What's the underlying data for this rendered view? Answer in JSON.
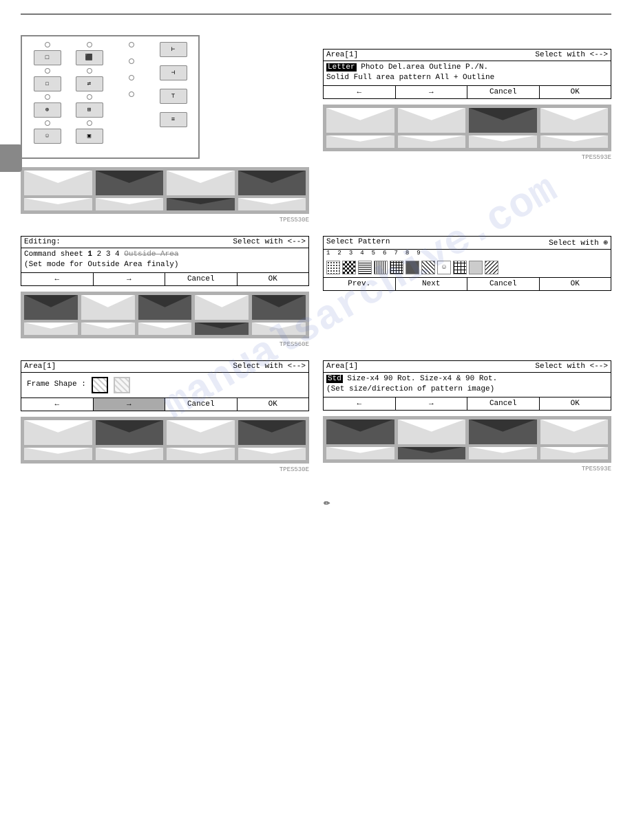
{
  "page": {
    "top_divider": true,
    "watermark": "manualsarchive.com"
  },
  "gray_tab": {
    "label": ""
  },
  "area1_dialog": {
    "title": "Area[1]",
    "select_label": "Select with <-->",
    "options_line1": "Letter  Photo  Del.area  Outline  P./N.",
    "options_line2": "Solid  Full area pattern  All + Outline",
    "highlighted": "Letter",
    "btn_left": "←",
    "btn_right": "→",
    "btn_cancel": "Cancel",
    "btn_ok": "OK"
  },
  "editing_dialog": {
    "title": "Editing:",
    "select_label": "Select with <-->",
    "line1": "Command sheet 1 2 3 4  Outside Area",
    "line1_bold": "1",
    "line1_strikethrough": "Outside Area",
    "line2": "(Set mode for Outside Area finaly)",
    "btn_left": "←",
    "btn_right": "→",
    "btn_cancel": "Cancel",
    "btn_ok": "OK"
  },
  "select_pattern_dialog": {
    "title": "Select Pattern",
    "select_label": "Select with ⊕",
    "numbers": [
      "1",
      "2",
      "3",
      "4",
      "5",
      "6",
      "7",
      "8",
      "9"
    ],
    "btn_prev": "Prev.",
    "btn_next": "Next",
    "btn_cancel": "Cancel",
    "btn_ok": "OK"
  },
  "area1_frame_dialog": {
    "title": "Area[1]",
    "select_label": "Select with <-->",
    "label": "Frame Shape :",
    "btn_left": "←",
    "btn_right": "→",
    "btn_cancel": "Cancel",
    "btn_ok": "OK"
  },
  "area1_size_dialog": {
    "title": "Area[1]",
    "select_label": "Select with <-->",
    "options": "Std  Size-x4  90 Rot.  Size-x4 & 90 Rot.",
    "highlighted": "Std",
    "line2": "(Set size/direction of pattern image)",
    "btn_left": "←",
    "btn_right": "→",
    "btn_cancel": "Cancel",
    "btn_ok": "OK"
  },
  "labels": {
    "tpes530e_1": "TPES530E",
    "tpes560e": "TPES560E",
    "tpes530e_2": "TPES530E",
    "tpes530e_3": "TPES530E",
    "tpes530e_4": "TPES530E",
    "tpes593e": "TPES593E"
  },
  "note_icon": "✏",
  "control_panel": {
    "rows": [
      [
        "○",
        "○",
        "○",
        "○"
      ],
      [
        "○",
        "○",
        "○",
        "○"
      ],
      [
        "○",
        "○",
        "○",
        "○"
      ],
      [
        "○",
        "○",
        "○",
        "○"
      ],
      [
        "○",
        "○",
        "○",
        "○"
      ]
    ]
  }
}
